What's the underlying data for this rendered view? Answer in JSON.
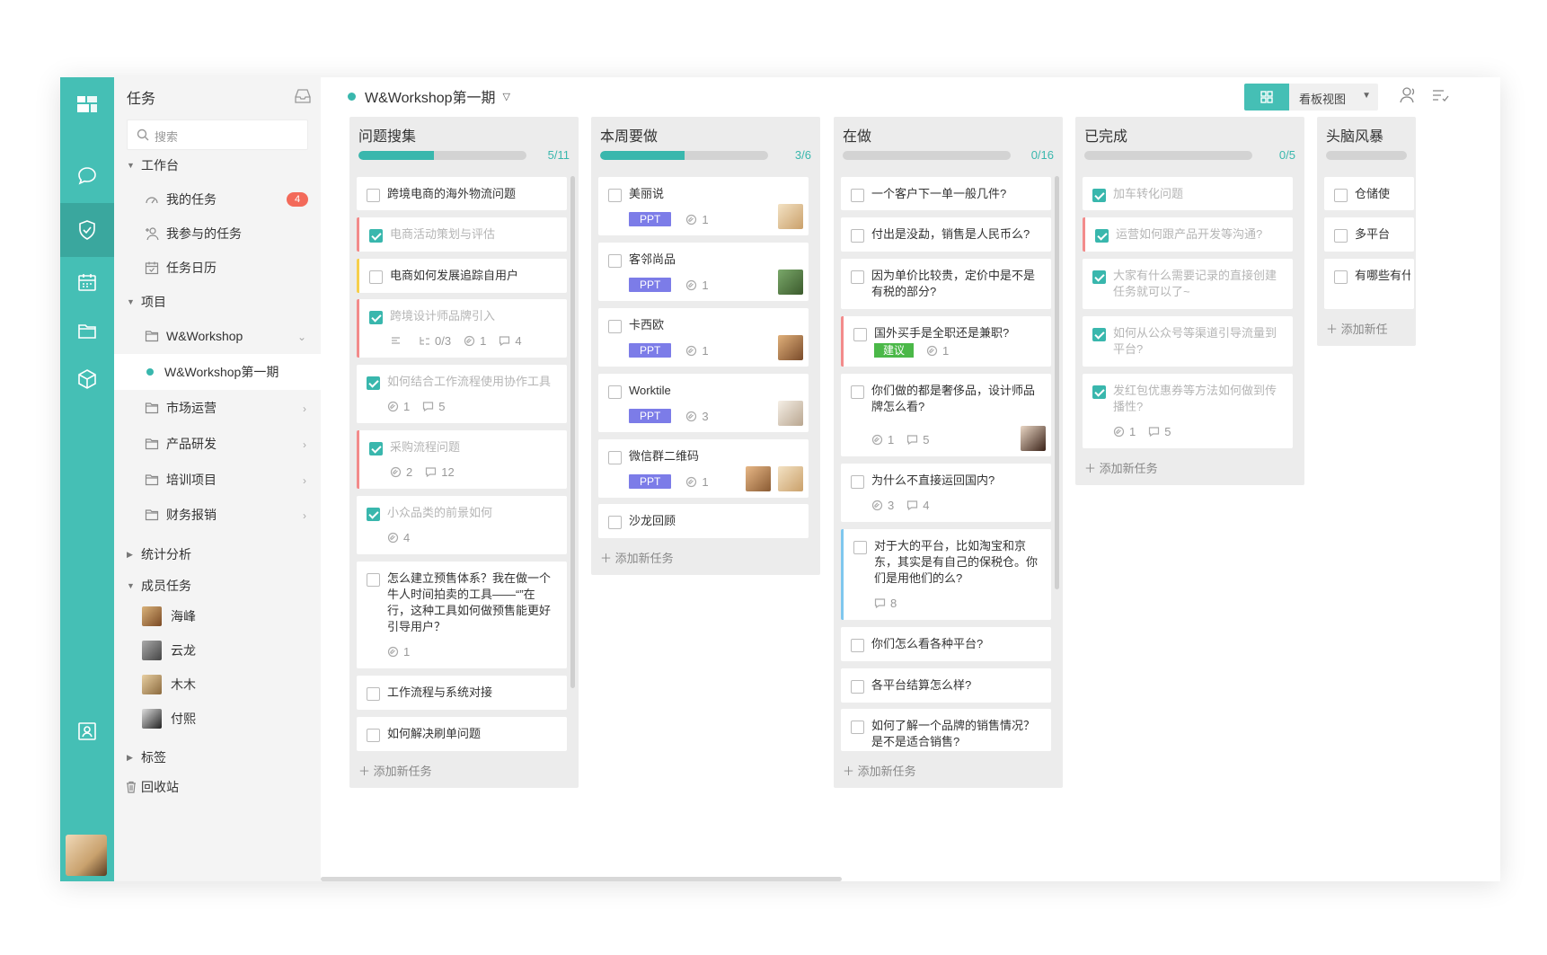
{
  "colors": {
    "accent": "#45bfb5",
    "rail": "#45bfb5",
    "badge": "#f36a5a",
    "ppt": "#7c7ce8",
    "tag_green": "#4bb848"
  },
  "rail": {
    "icons": [
      "logo-icon",
      "chat-icon",
      "task-icon",
      "calendar-icon",
      "folder-icon",
      "cube-icon",
      "contacts-icon"
    ],
    "active": "task-icon"
  },
  "sidebar": {
    "title": "任务",
    "search_placeholder": "搜索",
    "workspace": {
      "label": "工作台",
      "items": [
        {
          "label": "我的任务",
          "icon": "gauge-icon",
          "badge": "4"
        },
        {
          "label": "我参与的任务",
          "icon": "user-plus-icon"
        },
        {
          "label": "任务日历",
          "icon": "calendar-check-icon"
        }
      ]
    },
    "projects": {
      "label": "项目",
      "items": [
        {
          "label": "W&Workshop",
          "icon": "folder-icon",
          "chev": "⌄"
        },
        {
          "label": "W&Workshop第一期",
          "active": true
        },
        {
          "label": "市场运营",
          "icon": "folder-icon",
          "chev": "›"
        },
        {
          "label": "产品研发",
          "icon": "folder-icon",
          "chev": "›"
        },
        {
          "label": "培训项目",
          "icon": "folder-icon",
          "chev": "›"
        },
        {
          "label": "财务报销",
          "icon": "folder-icon",
          "chev": "›"
        }
      ]
    },
    "stats": "统计分析",
    "members": {
      "label": "成员任务",
      "items": [
        "海峰",
        "云龙",
        "木木",
        "付熙"
      ]
    },
    "tags": "标签",
    "trash": "回收站"
  },
  "header": {
    "project": "W&Workshop第一期",
    "view_label": "看板视图"
  },
  "columns": [
    {
      "title": "问题搜集",
      "count": "5/11",
      "progress": 0.45,
      "cards": [
        {
          "text": "跨境电商的海外物流问题",
          "done": false
        },
        {
          "text": "电商活动策划与评估",
          "done": true,
          "mark": "red"
        },
        {
          "text": "电商如何发展追踪自用户",
          "done": false,
          "mark": "yellow"
        },
        {
          "text": "跨境设计师品牌引入",
          "done": true,
          "mark": "red",
          "meta": {
            "subtasks": "0/3",
            "attach": "1",
            "comments": "4",
            "desc": true
          }
        },
        {
          "text": "如何结合工作流程使用协作工具",
          "done": true,
          "meta": {
            "attach": "1",
            "comments": "5"
          }
        },
        {
          "text": "采购流程问题",
          "done": true,
          "mark": "red",
          "meta": {
            "attach": "2",
            "comments": "12"
          }
        },
        {
          "text": "小众品类的前景如何",
          "done": true,
          "meta": {
            "attach": "4"
          }
        },
        {
          "text": "怎么建立预售体系？我在做一个牛人时间拍卖的工具——“”在行，这种工具如何做预售能更好引导用户？",
          "done": false,
          "meta": {
            "attach": "1"
          }
        },
        {
          "text": "工作流程与系统对接",
          "done": false
        },
        {
          "text": "如何解决刷单问题",
          "done": false
        }
      ],
      "add": "添加新任务"
    },
    {
      "title": "本周要做",
      "count": "3/6",
      "progress": 0.5,
      "cards": [
        {
          "text": "美丽说",
          "done": false,
          "tag": "PPT",
          "attach": "1"
        },
        {
          "text": "客邻尚品",
          "done": false,
          "tag": "PPT",
          "attach": "1"
        },
        {
          "text": "卡西欧",
          "done": false,
          "tag": "PPT",
          "attach": "1"
        },
        {
          "text": "Worktile",
          "done": false,
          "tag": "PPT",
          "attach": "3"
        },
        {
          "text": "微信群二维码",
          "done": false,
          "tag": "PPT",
          "attach": "1"
        },
        {
          "text": "沙龙回顾",
          "done": false
        }
      ],
      "add": "添加新任务"
    },
    {
      "title": "在做",
      "count": "0/16",
      "progress": 0,
      "cards": [
        {
          "text": "一个客户下一单一般几件?"
        },
        {
          "text": "付出是没勐，销售是人民币么?"
        },
        {
          "text": "因为单价比较贵，定价中是不是有税的部分?"
        },
        {
          "text": "国外买手是全职还是兼职?",
          "mark": "red",
          "tag": "建议",
          "attach": "1"
        },
        {
          "text": "你们做的都是奢侈品，设计师品牌怎么看?",
          "attach": "1",
          "comments": "5"
        },
        {
          "text": "为什么不直接运回国内?",
          "attach": "3",
          "comments": "4"
        },
        {
          "text": "对于大的平台，比如淘宝和京东，其实是有自己的保税仓。你们是用他们的么?",
          "mark": "blue",
          "comments": "8"
        },
        {
          "text": "你们怎么看各种平台?"
        },
        {
          "text": "各平台结算怎么样?"
        },
        {
          "text": "如何了解一个品牌的销售情况？是不是适合销售?"
        }
      ],
      "add": "添加新任务"
    },
    {
      "title": "已完成",
      "count": "0/5",
      "progress": 0,
      "cards": [
        {
          "text": "加车转化问题",
          "done": true
        },
        {
          "text": "运营如何跟产品开发等沟通?",
          "done": true,
          "mark": "red"
        },
        {
          "text": "大家有什么需要记录的直接创建任务就可以了~",
          "done": true
        },
        {
          "text": "如何从公众号等渠道引导流量到平台?",
          "done": true
        },
        {
          "text": "发红包优惠券等方法如何做到传播性?",
          "done": true,
          "attach": "1",
          "comments": "5"
        }
      ],
      "add": "添加新任务"
    },
    {
      "title": "头脑风暴",
      "cards": [
        {
          "text": "仓储使"
        },
        {
          "text": "多平台"
        },
        {
          "text": "有哪些有什么"
        }
      ],
      "add": "添加新任"
    }
  ]
}
